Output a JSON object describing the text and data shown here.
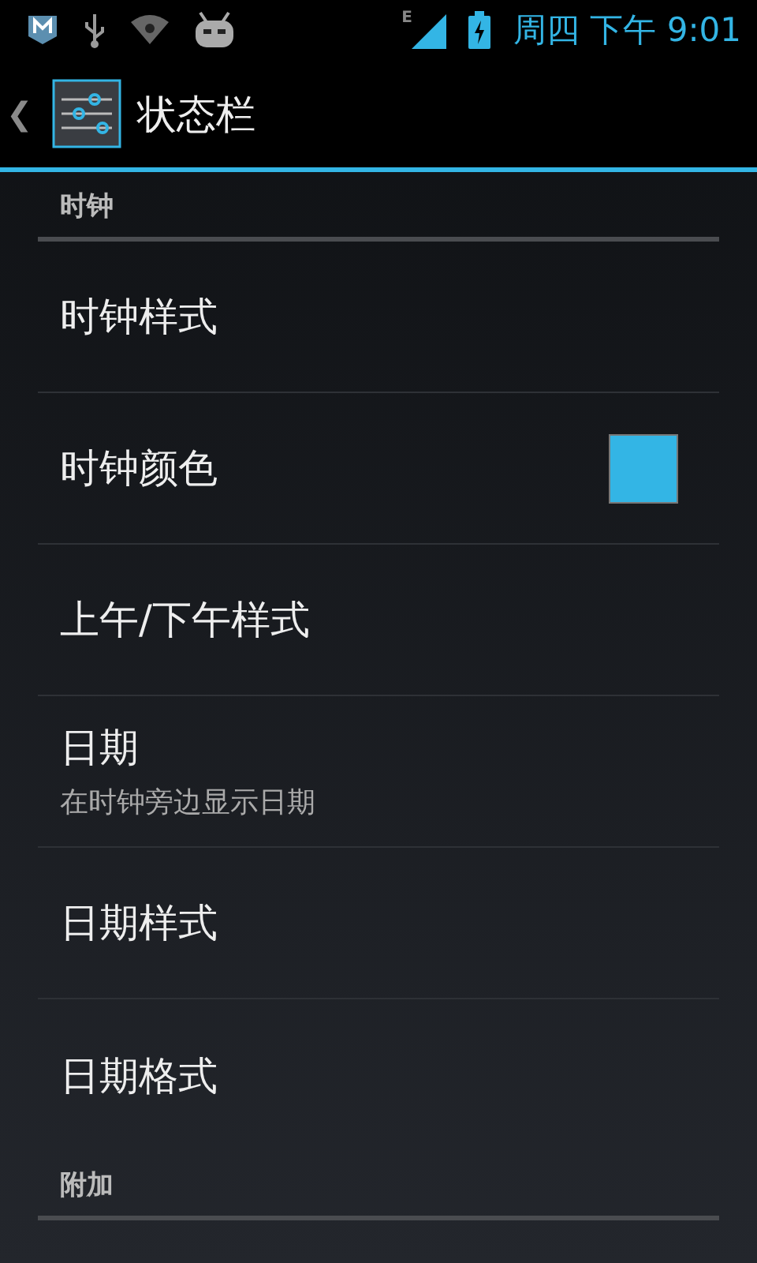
{
  "status_bar": {
    "network_type": "E",
    "time": "周四 下午 9:01"
  },
  "action_bar": {
    "back": "❮",
    "title": "状态栏"
  },
  "sections": [
    {
      "header": "时钟",
      "items": [
        {
          "kind": "plain",
          "title": "时钟样式"
        },
        {
          "kind": "color",
          "title": "时钟颜色",
          "color": "#33b5e5"
        },
        {
          "kind": "plain",
          "title": "上午/下午样式"
        },
        {
          "kind": "summary",
          "title": "日期",
          "summary": "在时钟旁边显示日期"
        },
        {
          "kind": "plain",
          "title": "日期样式"
        },
        {
          "kind": "plain",
          "title": "日期格式"
        }
      ]
    },
    {
      "header": "附加"
    }
  ]
}
